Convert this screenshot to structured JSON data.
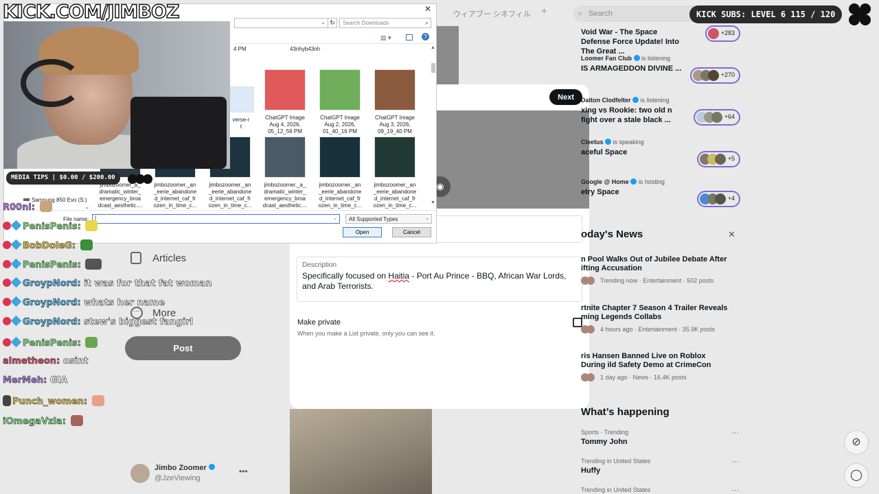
{
  "stream": {
    "url": "KICK.COM/JIMBOZ",
    "media_tips": "MEDIA TIPS | $0.00 / $200.00",
    "kick_subs": "KICK SUBS: LEVEL 6 115 / 120"
  },
  "chat": [
    {
      "user": "R00nl:",
      "message": "",
      "color": "#b27be0",
      "badges": false
    },
    {
      "user": "PenisPenis:",
      "message": "",
      "color": "#7fe07f",
      "badges": true
    },
    {
      "user": "BobDoleG:",
      "message": "",
      "color": "#e8c64a",
      "badges": true
    },
    {
      "user": "PenisPenis:",
      "message": "",
      "color": "#7fe07f",
      "badges": true
    },
    {
      "user": "GroypNord:",
      "message": "it was for that fat woman",
      "color": "#4db4e6",
      "badges": true
    },
    {
      "user": "GroypNord:",
      "message": "whats her name",
      "color": "#4db4e6",
      "badges": true
    },
    {
      "user": "GroypNord:",
      "message": "stew's biggest fangirl",
      "color": "#4db4e6",
      "badges": true
    },
    {
      "user": "PenisPenis:",
      "message": "",
      "color": "#7fe07f",
      "badges": true
    },
    {
      "user": "almetheon:",
      "message": "osint",
      "color": "#e04a6a",
      "badges": false
    },
    {
      "user": "MerMeh:",
      "message": "GIA",
      "color": "#b27be0",
      "badges": false
    },
    {
      "user": "Punch_women:",
      "message": "",
      "color": "#e8c64a",
      "badges": false
    },
    {
      "user": "iOmegaVzla:",
      "message": "",
      "color": "#7fe07f",
      "badges": false
    }
  ],
  "file_dialog": {
    "search_placeholder": "Search Downloads",
    "partial_top_left": "4 PM",
    "partial_top_right": "43nhyb43nh",
    "partial_selected": "verse-r\nt",
    "files_row1": [
      {
        "name": "ChatGPT Image\nAug 4, 2026,\n05_12_56 PM",
        "thumb": "#e05a5a"
      },
      {
        "name": "ChatGPT Image\nAug 2, 2026,\n01_40_16 PM",
        "thumb": "#6fae5a"
      },
      {
        "name": "ChatGPT Image\nAug 3, 2026,\n09_19_40 PM",
        "thumb": "#8a5a3c"
      }
    ],
    "files_row2": [
      {
        "name": "jimbozoomer_a_\ndramatic_winter_\nemergency_broa\ndcast_aesthetic....",
        "thumb": "#2a3a44"
      },
      {
        "name": "jimbozoomer._an\n_eerie_abandone\nd_internet_caf_fr\nozen_in_time_c...",
        "thumb": "#1d3340"
      },
      {
        "name": "jimbozoomer._an\n_eerie_abandone\nd_internet_caf_fr\nozen_in_time_c...",
        "thumb": "#1d3340"
      },
      {
        "name": "jimbozoomer._a_\ndramatic_winter_\nemergency_broa\ndcast_aesthetic....",
        "thumb": "#4a5a66"
      },
      {
        "name": "jimbozoomer._an\n_eerie_abandone\nd_internet_caf_fr\nozen_in_time_c...",
        "thumb": "#17323c"
      },
      {
        "name": "jimbozoomer._an\n_eerie_abandone\nd_internet_caf_fr\nozen_in_time_c...",
        "thumb": "#223a35"
      }
    ],
    "nav_drive": "Samsung 850 Evo (S:)",
    "filename_label": "File name:",
    "filename_value": "",
    "filetype": "All Supported Types",
    "open_label": "Open",
    "cancel_label": "Cancel"
  },
  "background": {
    "tab_text": "ウィアブー シネフィル",
    "search_placeholder": "Search",
    "nav": {
      "articles": "Articles",
      "more": "More",
      "post": "Post"
    },
    "account": {
      "name": "Jimbo Zoomer",
      "handle": "@JzeViewing"
    }
  },
  "modal": {
    "next_label": "Next",
    "description_label": "Description",
    "description_pre": "Specifically focused on ",
    "description_misspelled": "Haitia",
    "description_post": " - Port Au Prince - BBQ, African War Lords, and Arab Terrorists.",
    "private_label": "Make private",
    "private_hint": "When you make a List private, only you can see it."
  },
  "spaces": [
    {
      "host": "",
      "status": "",
      "title": "Void War - The Space Defense Force Update! Into The Great ...",
      "count": "+283"
    },
    {
      "host": "Loomer Fan Club",
      "status": "is listening",
      "title": "IS ARMAGEDDON DIVINE ...",
      "count": "+270"
    },
    {
      "host": "Dalton Clodfelter",
      "status": "is listening",
      "title": "xing vs Rookie: two old n fight over a stale black ...",
      "count": "+64"
    },
    {
      "host": "Cleetus",
      "status": "is speaking",
      "title": "aceful Space",
      "count": "+5"
    },
    {
      "host": "Google @ Home",
      "status": "is hosting",
      "title": "etry Space",
      "count": "+4"
    }
  ],
  "news": {
    "title": "oday's News",
    "items": [
      {
        "headline": "n Pool Walks Out of Jubilee Debate After ifting Accusation",
        "meta": "Trending now · Entertainment · 502 posts"
      },
      {
        "headline": "rtnite Chapter 7 Season 4 Trailer Reveals ming Legends Collabs",
        "meta": "4 hours ago · Entertainment · 35.9K posts"
      },
      {
        "headline": "ris Hansen Banned Live on Roblox During ild Safety Demo at CrimeCon",
        "meta": "1 day ago · News · 16.4K posts"
      }
    ]
  },
  "happening": {
    "title": "What’s happening",
    "trends": [
      {
        "category": "Sports · Trending",
        "name": "Tommy John"
      },
      {
        "category": "Trending in United States",
        "name": "Huffy"
      },
      {
        "category": "Trending in United States",
        "name": ""
      }
    ]
  }
}
